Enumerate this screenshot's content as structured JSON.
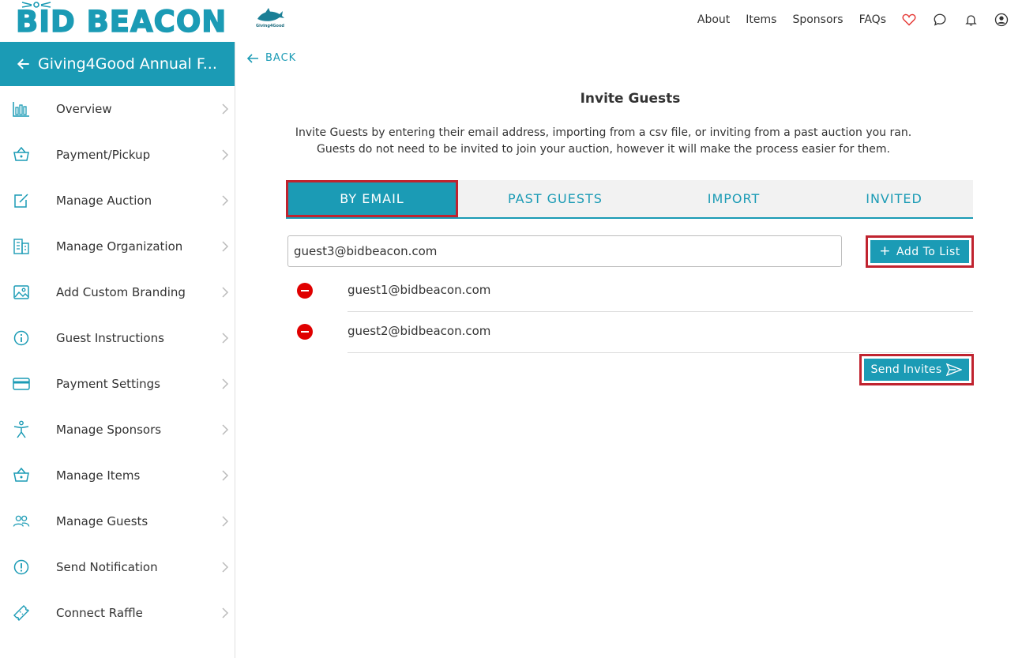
{
  "brand": {
    "logo_text": "BID BEACON",
    "org_logo_text": "Giving4Good"
  },
  "colors": {
    "accent": "#1b9bb5",
    "highlight_border": "#c0232f",
    "remove": "#e00000"
  },
  "topnav": {
    "links": [
      "About",
      "Items",
      "Sponsors",
      "FAQs"
    ],
    "icons": [
      "heart-icon",
      "chat-icon",
      "bell-icon",
      "account-icon"
    ]
  },
  "sidebar": {
    "header_title": "Giving4Good Annual F...",
    "items": [
      {
        "label": "Overview",
        "icon": "bar-chart-icon"
      },
      {
        "label": "Payment/Pickup",
        "icon": "basket-icon"
      },
      {
        "label": "Manage Auction",
        "icon": "edit-icon"
      },
      {
        "label": "Manage Organization",
        "icon": "building-icon"
      },
      {
        "label": "Add Custom Branding",
        "icon": "image-icon"
      },
      {
        "label": "Guest Instructions",
        "icon": "info-icon"
      },
      {
        "label": "Payment Settings",
        "icon": "credit-card-icon"
      },
      {
        "label": "Manage Sponsors",
        "icon": "person-icon"
      },
      {
        "label": "Manage Items",
        "icon": "basket-icon"
      },
      {
        "label": "Manage Guests",
        "icon": "people-icon"
      },
      {
        "label": "Send Notification",
        "icon": "alert-icon"
      },
      {
        "label": "Connect Raffle",
        "icon": "ticket-icon"
      }
    ]
  },
  "main": {
    "back_label": "BACK",
    "title": "Invite Guests",
    "description": "Invite Guests by entering their email address, importing from a csv file, or inviting from a past auction you ran. Guests do not need to be invited to join your auction, however it will make the process easier for them.",
    "tabs": [
      {
        "label": "BY EMAIL",
        "active": true
      },
      {
        "label": "PAST GUESTS",
        "active": false
      },
      {
        "label": "IMPORT",
        "active": false
      },
      {
        "label": "INVITED",
        "active": false
      }
    ],
    "email_input_value": "guest3@bidbeacon.com",
    "add_button_label": "Add To List",
    "guests": [
      "guest1@bidbeacon.com",
      "guest2@bidbeacon.com"
    ],
    "send_button_label": "Send Invites"
  }
}
